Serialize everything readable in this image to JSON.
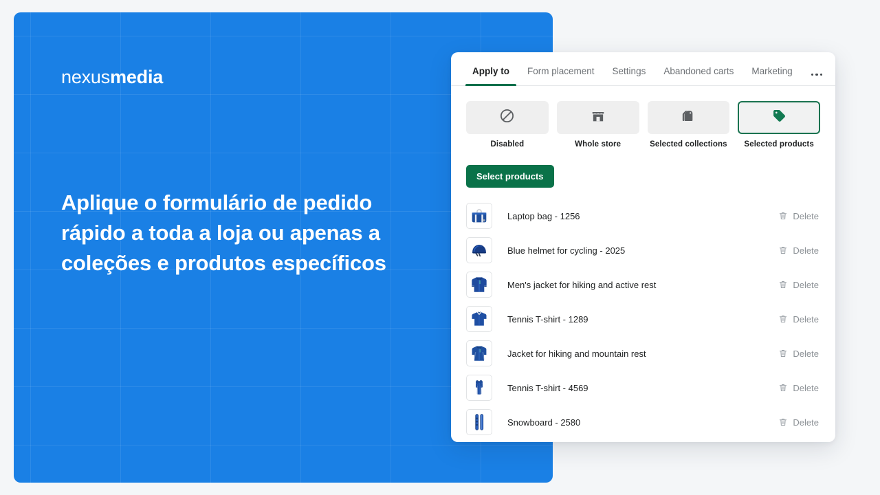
{
  "hero": {
    "logo_light": "nexus",
    "logo_bold": "media",
    "headline": "Aplique o formulário de pedido rápido a toda a loja ou apenas a coleções e produtos específicos",
    "background_color": "#1a80e5"
  },
  "card": {
    "tabs": [
      {
        "label": "Apply to",
        "active": true
      },
      {
        "label": "Form placement",
        "active": false
      },
      {
        "label": "Settings",
        "active": false
      },
      {
        "label": "Abandoned carts",
        "active": false
      },
      {
        "label": "Marketing",
        "active": false
      }
    ],
    "overflow_icon": "ellipsis-icon",
    "accent_color": "#0a7249",
    "options": [
      {
        "label": "Disabled",
        "icon": "no-entry-icon",
        "selected": false
      },
      {
        "label": "Whole store",
        "icon": "storefront-icon",
        "selected": false
      },
      {
        "label": "Selected collections",
        "icon": "collection-tags-icon",
        "selected": false
      },
      {
        "label": "Selected products",
        "icon": "product-tag-icon",
        "selected": true
      }
    ],
    "select_products_label": "Select products",
    "delete_label": "Delete",
    "products": [
      {
        "title": "Laptop bag - 1256",
        "thumb": "laptop-bag"
      },
      {
        "title": "Blue helmet for cycling - 2025",
        "thumb": "helmet"
      },
      {
        "title": "Men's jacket for hiking and active rest",
        "thumb": "hoodie"
      },
      {
        "title": "Tennis T-shirt - 1289",
        "thumb": "polo"
      },
      {
        "title": "Jacket for hiking and mountain rest",
        "thumb": "jacket"
      },
      {
        "title": "Tennis T-shirt - 4569",
        "thumb": "tanktop"
      },
      {
        "title": "Snowboard - 2580",
        "thumb": "snowboard"
      }
    ]
  }
}
